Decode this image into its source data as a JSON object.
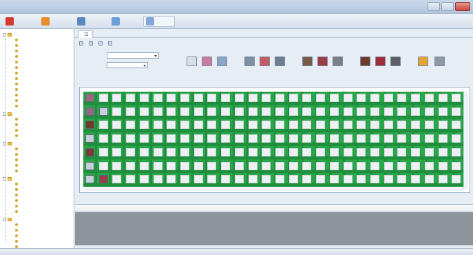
{
  "window": {
    "title": "",
    "colors": {
      "grid_green": "#2aa64a",
      "grid_cell": "#eef1f4",
      "list_body": "#8e949c"
    }
  },
  "toolbar": {
    "items": [
      {
        "icon": "power-icon",
        "label": "",
        "color": "#d43b2f"
      },
      {
        "icon": "logout-icon",
        "label": "",
        "color": "#e88b2a"
      },
      {
        "icon": "user-icon",
        "label": "",
        "color": "#5a86c2"
      },
      {
        "icon": "layout-icon",
        "label": "",
        "color": "#6aa0d6"
      },
      {
        "icon": "window-icon",
        "label": "",
        "color": "#7fa8d8"
      }
    ]
  },
  "tabs": [
    {
      "label": ""
    },
    {
      "label": ""
    }
  ],
  "form": {
    "field1_label": "",
    "field1_value": "",
    "field2_label": "",
    "field2_value": ""
  },
  "icon_group": {
    "label": "",
    "buttons": [
      {
        "icon": "disabled-tool-icon",
        "caption": "",
        "color": "#d9dee6"
      },
      {
        "icon": "chart-tool-icon",
        "caption": "",
        "color": "#c87aa3"
      },
      {
        "icon": "gear-tool-icon",
        "caption": "",
        "color": "#8aa4c6"
      },
      {
        "icon": "monitor-icon",
        "caption": "",
        "color": "#7f8ea3"
      },
      {
        "icon": "monitor-red-icon",
        "caption": "",
        "color": "#c45a63"
      },
      {
        "icon": "monitor-dark-icon",
        "caption": "",
        "color": "#6f7d90"
      },
      {
        "icon": "device-icon",
        "caption": "",
        "color": "#7a5a4a"
      },
      {
        "icon": "device-red-icon",
        "caption": "",
        "color": "#9a3d46"
      },
      {
        "icon": "device-gray-icon",
        "caption": "",
        "color": "#7b7f86"
      },
      {
        "icon": "box-icon",
        "caption": "",
        "color": "#6e3b2b"
      },
      {
        "icon": "box-red-icon",
        "caption": "",
        "color": "#9d2f3a"
      },
      {
        "icon": "box-dark-icon",
        "caption": "",
        "color": "#5d5f66"
      },
      {
        "icon": "lamp-icon",
        "caption": "",
        "color": "#e3a33a"
      },
      {
        "icon": "printer-icon",
        "caption": "",
        "color": "#8f97a3"
      }
    ]
  },
  "tree": {
    "groups": [
      {
        "label": "",
        "children": [
          "",
          "",
          "",
          "",
          "",
          "",
          "",
          "",
          "",
          "",
          "",
          "",
          ""
        ]
      },
      {
        "label": "",
        "children": [
          "",
          "",
          "",
          ""
        ]
      },
      {
        "label": "",
        "children": [
          "",
          "",
          "",
          "",
          ""
        ]
      },
      {
        "label": "",
        "children": [
          "",
          "",
          "",
          "",
          "",
          ""
        ]
      },
      {
        "label": "",
        "children": [
          "",
          "",
          "",
          "",
          "",
          ""
        ]
      }
    ]
  },
  "grid": {
    "rows": 7,
    "cols": 28,
    "filled_cells": [
      {
        "row": 0,
        "col": 0,
        "icon": "monitor-thumb-icon",
        "color": "#9c6a7e"
      },
      {
        "row": 1,
        "col": 0,
        "icon": "monitor-thumb-icon",
        "color": "#8e6a84"
      },
      {
        "row": 1,
        "col": 1,
        "icon": "screen-thumb-icon",
        "color": "#c7cfd9"
      },
      {
        "row": 2,
        "col": 0,
        "icon": "device-thumb-icon",
        "color": "#6e3b2b"
      },
      {
        "row": 3,
        "col": 0,
        "icon": "screen-thumb-icon",
        "color": "#c7cfd9"
      },
      {
        "row": 4,
        "col": 0,
        "icon": "device-thumb-icon",
        "color": "#7a3b33"
      },
      {
        "row": 5,
        "col": 0,
        "icon": "screen-thumb-icon",
        "color": "#c7cfd9"
      },
      {
        "row": 6,
        "col": 0,
        "icon": "screen-thumb-icon",
        "color": "#c7cfd9"
      },
      {
        "row": 6,
        "col": 1,
        "icon": "device-thumb-icon",
        "color": "#9a3d46"
      }
    ]
  },
  "list": {
    "columns": [
      "",
      "",
      "",
      "",
      "",
      "",
      "",
      "",
      "",
      "",
      "",
      "",
      ""
    ]
  },
  "statusbar": {
    "items": [
      "",
      "",
      "",
      "",
      ""
    ]
  }
}
